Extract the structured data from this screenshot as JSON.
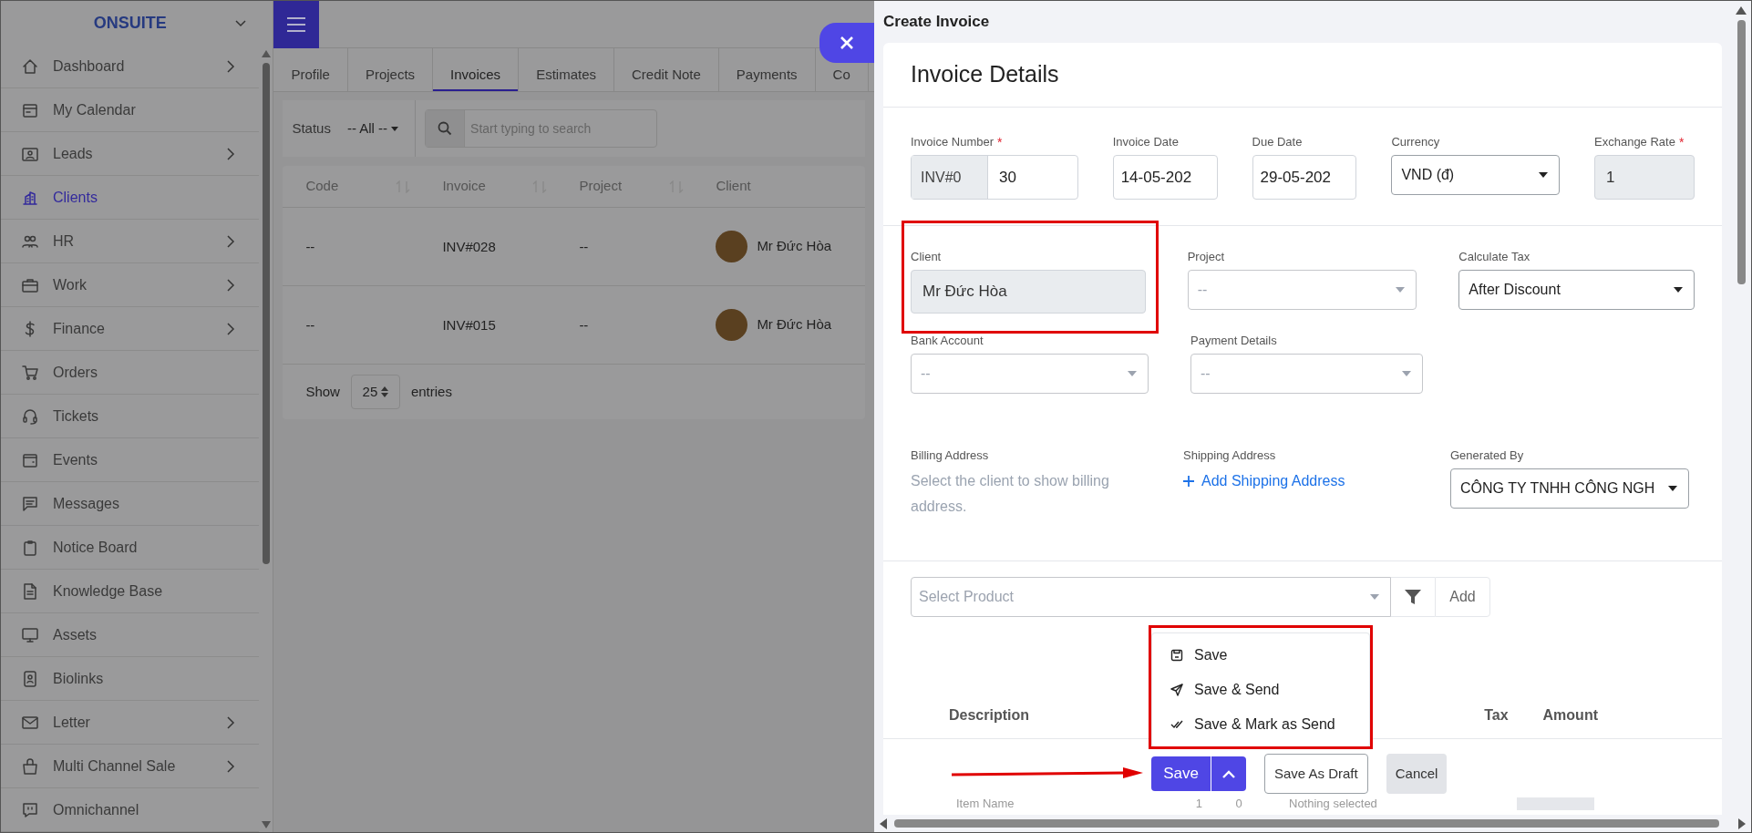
{
  "sidebar": {
    "brand": "ONSUITE",
    "items": [
      {
        "label": "Dashboard",
        "submenu": true,
        "selected": false
      },
      {
        "label": "My Calendar",
        "submenu": false,
        "selected": false
      },
      {
        "label": "Leads",
        "submenu": true,
        "selected": false
      },
      {
        "label": "Clients",
        "submenu": false,
        "selected": true
      },
      {
        "label": "HR",
        "submenu": true,
        "selected": false
      },
      {
        "label": "Work",
        "submenu": true,
        "selected": false
      },
      {
        "label": "Finance",
        "submenu": true,
        "selected": false
      },
      {
        "label": "Orders",
        "submenu": false,
        "selected": false
      },
      {
        "label": "Tickets",
        "submenu": false,
        "selected": false
      },
      {
        "label": "Events",
        "submenu": false,
        "selected": false
      },
      {
        "label": "Messages",
        "submenu": false,
        "selected": false
      },
      {
        "label": "Notice Board",
        "submenu": false,
        "selected": false
      },
      {
        "label": "Knowledge Base",
        "submenu": false,
        "selected": false
      },
      {
        "label": "Assets",
        "submenu": false,
        "selected": false
      },
      {
        "label": "Biolinks",
        "submenu": false,
        "selected": false
      },
      {
        "label": "Letter",
        "submenu": true,
        "selected": false
      },
      {
        "label": "Multi Channel Sale",
        "submenu": true,
        "selected": false
      },
      {
        "label": "Omnichannel",
        "submenu": false,
        "selected": false
      }
    ]
  },
  "tabs": [
    {
      "label": "Profile",
      "selected": false
    },
    {
      "label": "Projects",
      "selected": false
    },
    {
      "label": "Invoices",
      "selected": true
    },
    {
      "label": "Estimates",
      "selected": false
    },
    {
      "label": "Credit Note",
      "selected": false
    },
    {
      "label": "Payments",
      "selected": false
    },
    {
      "label": "Co",
      "selected": false
    }
  ],
  "filters": {
    "status_label": "Status",
    "status_value": "-- All --",
    "search_placeholder": "Start typing to search"
  },
  "table": {
    "columns": [
      "Code",
      "Invoice",
      "Project",
      "Client"
    ],
    "rows": [
      {
        "code": "--",
        "invoice": "INV#028",
        "project": "--",
        "client": "Mr Đức Hòa"
      },
      {
        "code": "--",
        "invoice": "INV#015",
        "project": "--",
        "client": "Mr Đức Hòa"
      }
    ],
    "show_label": "Show",
    "page_size": "25",
    "entries_label": "entries"
  },
  "panel": {
    "title": "Create Invoice",
    "heading": "Invoice Details",
    "rows": [
      [
        {
          "kind": "prefixed",
          "label": "Invoice Number",
          "required_mark": "*",
          "prefix": "INV#0",
          "value": "30"
        },
        {
          "kind": "input",
          "label": "Invoice Date",
          "value": "14-05-202"
        },
        {
          "kind": "input",
          "label": "Due Date",
          "value": "29-05-202"
        },
        {
          "kind": "select",
          "label": "Currency",
          "value": "VND (đ)"
        },
        {
          "kind": "readonly",
          "label": "Exchange Rate",
          "required_mark": "*",
          "value": "1"
        }
      ],
      [
        {
          "kind": "readonly",
          "label": "Client",
          "value": "Mr Đức Hòa",
          "highlighted": true
        },
        {
          "kind": "select",
          "label": "Project",
          "placeholder": "--"
        },
        {
          "kind": "select",
          "label": "Calculate Tax",
          "value": "After Discount"
        }
      ],
      [
        {
          "kind": "select",
          "label": "Bank Account",
          "placeholder": "--"
        },
        {
          "kind": "select",
          "label": "Payment Details",
          "placeholder": "--"
        }
      ],
      [
        {
          "kind": "text",
          "label": "Billing Address",
          "value": "Select the client to show billing address."
        },
        {
          "kind": "link",
          "label": "Shipping Address",
          "value": "Add Shipping Address"
        },
        {
          "kind": "select",
          "label": "Generated By",
          "value": "CÔNG TY TNHH CÔNG NGH"
        }
      ]
    ],
    "product": {
      "placeholder": "Select Product",
      "add": "Add"
    },
    "save_menu": {
      "highlighted": true,
      "items": [
        {
          "kind": "save",
          "label": "Save"
        },
        {
          "kind": "send",
          "label": "Save & Send"
        },
        {
          "kind": "mark",
          "label": "Save & Mark as Send"
        }
      ]
    },
    "item_columns": [
      {
        "label": "Description"
      },
      {
        "label": "Tax"
      },
      {
        "label": "Amount"
      }
    ],
    "actions": {
      "save": "Save",
      "draft": "Save As Draft",
      "cancel": "Cancel"
    },
    "item_row": {
      "name": "Item Name",
      "quantity": "1",
      "price": "0",
      "tax": "Nothing selected"
    }
  }
}
